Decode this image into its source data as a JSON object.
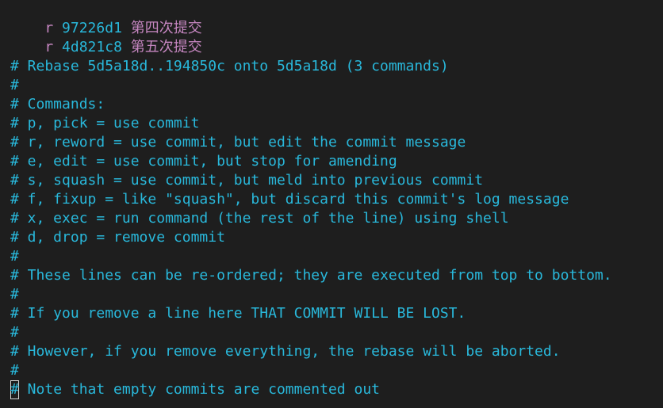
{
  "todo": [
    {
      "cmd": "r",
      "hash": "97226d1",
      "message": "第四次提交"
    },
    {
      "cmd": "r",
      "hash": "4d821c8",
      "message": "第五次提交"
    }
  ],
  "comments": [
    "",
    "# Rebase 5d5a18d..194850c onto 5d5a18d (3 commands)",
    "#",
    "# Commands:",
    "# p, pick = use commit",
    "# r, reword = use commit, but edit the commit message",
    "# e, edit = use commit, but stop for amending",
    "# s, squash = use commit, but meld into previous commit",
    "# f, fixup = like \"squash\", but discard this commit's log message",
    "# x, exec = run command (the rest of the line) using shell",
    "# d, drop = remove commit",
    "#",
    "# These lines can be re-ordered; they are executed from top to bottom.",
    "#",
    "# If you remove a line here THAT COMMIT WILL BE LOST.",
    "#",
    "# However, if you remove everything, the rebase will be aborted.",
    "#"
  ],
  "last_line": {
    "cursor_char": "#",
    "rest": " Note that empty commits are commented out"
  },
  "colors": {
    "background": "#1e1e1e",
    "command": "#c586c0",
    "comment": "#29b8db"
  }
}
